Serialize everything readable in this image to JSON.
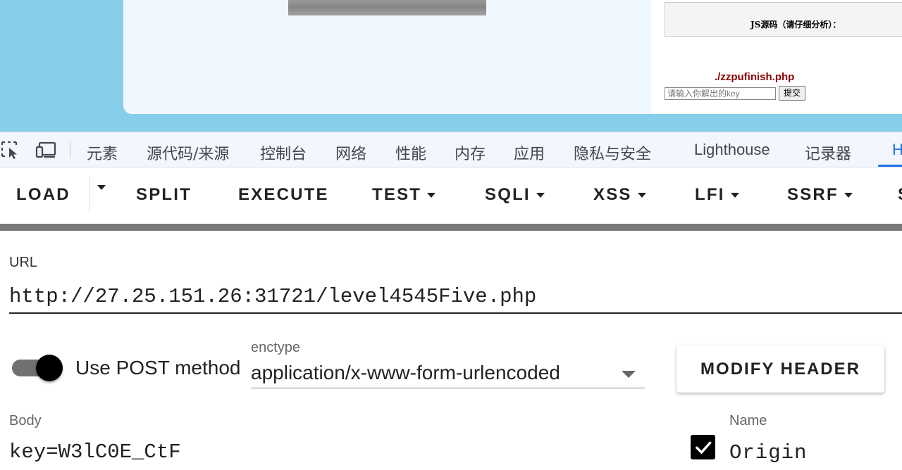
{
  "webpage": {
    "js_source_title": "JS源码（请仔细分析）：",
    "finish_link": "./zzpufinish.php",
    "key_placeholder": "请输入你解出的key",
    "submit_label": "提交"
  },
  "devtools": {
    "tabs": [
      {
        "label": "元素"
      },
      {
        "label": "源代码/来源"
      },
      {
        "label": "控制台"
      },
      {
        "label": "网络"
      },
      {
        "label": "性能"
      },
      {
        "label": "内存"
      },
      {
        "label": "应用"
      },
      {
        "label": "隐私与安全"
      },
      {
        "label": "Lighthouse"
      },
      {
        "label": "记录器"
      },
      {
        "label": "H"
      }
    ],
    "active_color": "#1a73e8"
  },
  "hackbar": {
    "buttons": {
      "load": "LOAD",
      "split": "SPLIT",
      "execute": "EXECUTE",
      "test": "TEST",
      "sqli": "SQLI",
      "xss": "XSS",
      "lfi": "LFI",
      "ssrf": "SSRF",
      "more": "S"
    },
    "url_label": "URL",
    "url_value": "http://27.25.151.26:31721/level4545Five.php",
    "post_toggle_label": "Use POST method",
    "post_enabled": true,
    "enctype_label": "enctype",
    "enctype_value": "application/x-www-form-urlencoded",
    "modify_header_label": "MODIFY HEADER",
    "body_label": "Body",
    "body_value": "key=W3lC0E_CtF",
    "header": {
      "enabled": true,
      "name_label": "Name",
      "name_value": "Origin"
    }
  }
}
